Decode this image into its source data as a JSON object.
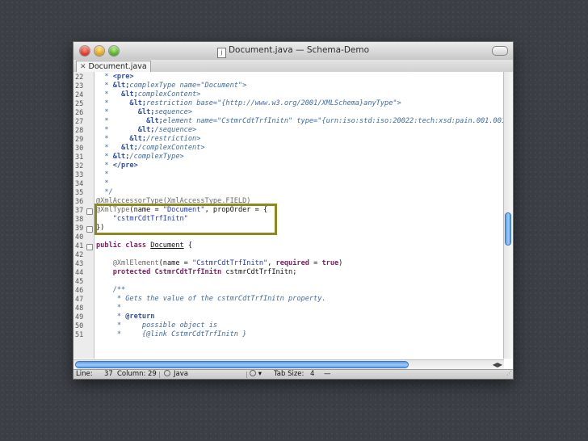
{
  "window": {
    "title": "Document.java — Schema-Demo"
  },
  "tab": {
    "label": "Document.java"
  },
  "editor": {
    "lines": [
      {
        "n": "22",
        "fold": false,
        "segs": [
          {
            "t": "  * ",
            "c": "c"
          },
          {
            "t": "<pre>",
            "c": "ct"
          }
        ]
      },
      {
        "n": "23",
        "fold": false,
        "segs": [
          {
            "t": "  * ",
            "c": "c"
          },
          {
            "t": "&lt;",
            "c": "ct"
          },
          {
            "t": "complexType name=\"Document\">",
            "c": "c"
          }
        ]
      },
      {
        "n": "24",
        "fold": false,
        "segs": [
          {
            "t": "  *   ",
            "c": "c"
          },
          {
            "t": "&lt;",
            "c": "ct"
          },
          {
            "t": "complexContent>",
            "c": "c"
          }
        ]
      },
      {
        "n": "25",
        "fold": false,
        "segs": [
          {
            "t": "  *     ",
            "c": "c"
          },
          {
            "t": "&lt;",
            "c": "ct"
          },
          {
            "t": "restriction base=\"{http://www.w3.org/2001/XMLSchema}anyType\">",
            "c": "c"
          }
        ]
      },
      {
        "n": "26",
        "fold": false,
        "segs": [
          {
            "t": "  *       ",
            "c": "c"
          },
          {
            "t": "&lt;",
            "c": "ct"
          },
          {
            "t": "sequence>",
            "c": "c"
          }
        ]
      },
      {
        "n": "27",
        "fold": false,
        "segs": [
          {
            "t": "  *         ",
            "c": "c"
          },
          {
            "t": "&lt;",
            "c": "ct"
          },
          {
            "t": "element name=\"CstmrCdtTrfInitn\" type=\"{urn:iso:std:iso:20022:tech:xsd:pain.001.001.0",
            "c": "c"
          }
        ]
      },
      {
        "n": "28",
        "fold": false,
        "segs": [
          {
            "t": "  *       ",
            "c": "c"
          },
          {
            "t": "&lt;",
            "c": "ct"
          },
          {
            "t": "/sequence>",
            "c": "c"
          }
        ]
      },
      {
        "n": "29",
        "fold": false,
        "segs": [
          {
            "t": "  *     ",
            "c": "c"
          },
          {
            "t": "&lt;",
            "c": "ct"
          },
          {
            "t": "/restriction>",
            "c": "c"
          }
        ]
      },
      {
        "n": "30",
        "fold": false,
        "segs": [
          {
            "t": "  *   ",
            "c": "c"
          },
          {
            "t": "&lt;",
            "c": "ct"
          },
          {
            "t": "/complexContent>",
            "c": "c"
          }
        ]
      },
      {
        "n": "31",
        "fold": false,
        "segs": [
          {
            "t": "  * ",
            "c": "c"
          },
          {
            "t": "&lt;",
            "c": "ct"
          },
          {
            "t": "/complexType>",
            "c": "c"
          }
        ]
      },
      {
        "n": "32",
        "fold": false,
        "segs": [
          {
            "t": "  * ",
            "c": "c"
          },
          {
            "t": "</pre>",
            "c": "ct"
          }
        ]
      },
      {
        "n": "33",
        "fold": false,
        "segs": [
          {
            "t": "  *",
            "c": "c"
          }
        ]
      },
      {
        "n": "34",
        "fold": false,
        "segs": [
          {
            "t": "  *",
            "c": "c"
          }
        ]
      },
      {
        "n": "35",
        "fold": false,
        "segs": [
          {
            "t": "  */",
            "c": "c"
          }
        ]
      },
      {
        "n": "36",
        "fold": false,
        "segs": [
          {
            "t": "@XmlAccessorType(XmlAccessType.FIELD)",
            "c": "an"
          }
        ]
      },
      {
        "n": "37",
        "fold": true,
        "segs": [
          {
            "t": "@XmlType",
            "c": "an"
          },
          {
            "t": "(name = ",
            "c": ""
          },
          {
            "t": "\"Document\"",
            "c": "s"
          },
          {
            "t": ", propOrder = {",
            "c": ""
          }
        ]
      },
      {
        "n": "38",
        "fold": false,
        "segs": [
          {
            "t": "    ",
            "c": ""
          },
          {
            "t": "\"cstmrCdtTrfInitn\"",
            "c": "s"
          }
        ]
      },
      {
        "n": "39",
        "fold": true,
        "segs": [
          {
            "t": "})",
            "c": ""
          }
        ]
      },
      {
        "n": "40",
        "fold": false,
        "segs": [
          {
            "t": "",
            "c": ""
          }
        ]
      },
      {
        "n": "41",
        "fold": true,
        "segs": [
          {
            "t": "public class ",
            "c": "k"
          },
          {
            "t": "Document",
            "c": "ul"
          },
          {
            "t": " {",
            "c": ""
          }
        ]
      },
      {
        "n": "42",
        "fold": false,
        "segs": [
          {
            "t": "",
            "c": ""
          }
        ]
      },
      {
        "n": "43",
        "fold": false,
        "segs": [
          {
            "t": "    ",
            "c": ""
          },
          {
            "t": "@XmlElement",
            "c": "an"
          },
          {
            "t": "(name = ",
            "c": ""
          },
          {
            "t": "\"CstmrCdtTrfInitn\"",
            "c": "s"
          },
          {
            "t": ", ",
            "c": ""
          },
          {
            "t": "required",
            "c": "k"
          },
          {
            "t": " = ",
            "c": ""
          },
          {
            "t": "true",
            "c": "k"
          },
          {
            "t": ")",
            "c": ""
          }
        ]
      },
      {
        "n": "44",
        "fold": false,
        "segs": [
          {
            "t": "    ",
            "c": ""
          },
          {
            "t": "protected ",
            "c": "k"
          },
          {
            "t": "CstmrCdtTrfInitn",
            "c": "k"
          },
          {
            "t": " cstmrCdtTrfInitn;",
            "c": ""
          }
        ]
      },
      {
        "n": "45",
        "fold": false,
        "segs": [
          {
            "t": "",
            "c": ""
          }
        ]
      },
      {
        "n": "46",
        "fold": false,
        "segs": [
          {
            "t": "    /**",
            "c": "c"
          }
        ]
      },
      {
        "n": "47",
        "fold": false,
        "segs": [
          {
            "t": "     * Gets the value of the cstmrCdtTrfInitn property.",
            "c": "c"
          }
        ]
      },
      {
        "n": "48",
        "fold": false,
        "segs": [
          {
            "t": "     *",
            "c": "c"
          }
        ]
      },
      {
        "n": "49",
        "fold": false,
        "segs": [
          {
            "t": "     * ",
            "c": "c"
          },
          {
            "t": "@return",
            "c": "ct"
          }
        ]
      },
      {
        "n": "50",
        "fold": false,
        "segs": [
          {
            "t": "     *     possible object is",
            "c": "c"
          }
        ]
      },
      {
        "n": "51",
        "fold": false,
        "segs": [
          {
            "t": "     *     {@link CstmrCdtTrfInitn }",
            "c": "c"
          }
        ]
      }
    ]
  },
  "status": {
    "line_label": "Line:",
    "line_value": "37",
    "column_label": "Column:",
    "column_value": "29",
    "language": "Java",
    "tab_size_label": "Tab Size:",
    "tab_size_value": "4",
    "symbol": "—"
  },
  "scroll": {
    "vertical_position": 0.55,
    "vertical_visible": 0.45,
    "horizontal_position": 0.0,
    "horizontal_visible": 0.92
  },
  "highlight": {
    "from_line": "37",
    "to_line": "39",
    "color": "#8c8a1e"
  }
}
